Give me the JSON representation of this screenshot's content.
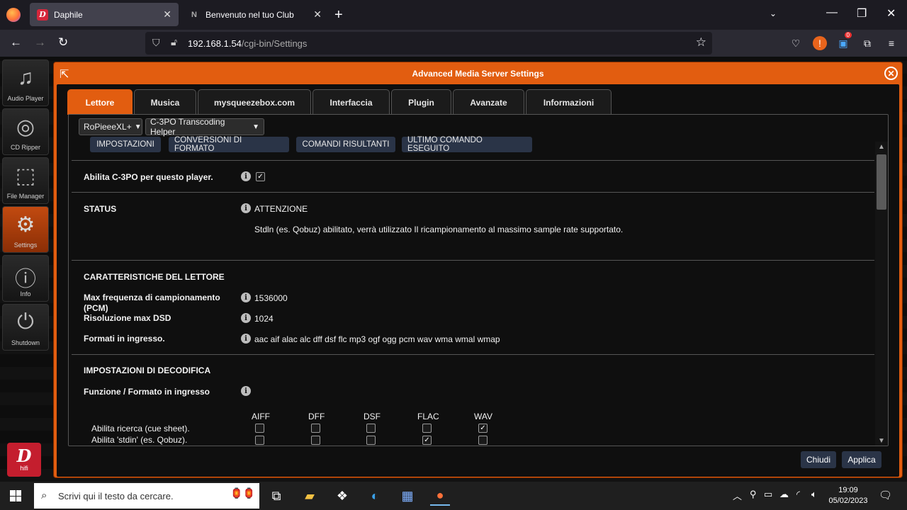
{
  "browser": {
    "tabs": [
      {
        "title": "Daphile",
        "favicon": "D"
      },
      {
        "title": "Benvenuto nel tuo Club",
        "favicon": "N"
      }
    ],
    "url_host": "192.168.1.54",
    "url_path": "/cgi-bin/Settings",
    "notification_count": "0"
  },
  "sidebar": {
    "items": [
      {
        "label": "Audio Player",
        "icon": "music-note-icon"
      },
      {
        "label": "CD Ripper",
        "icon": "disc-icon"
      },
      {
        "label": "File Manager",
        "icon": "box-icon"
      },
      {
        "label": "Settings",
        "icon": "gears-icon"
      },
      {
        "label": "Info",
        "icon": "info-icon"
      },
      {
        "label": "Shutdown",
        "icon": "power-icon"
      }
    ],
    "logo_letter": "D",
    "logo_text": "hifi"
  },
  "dialog": {
    "title": "Advanced Media Server Settings",
    "tabs": [
      "Lettore",
      "Musica",
      "mysqueezebox.com",
      "Interfaccia",
      "Plugin",
      "Avanzate",
      "Informazioni"
    ],
    "player_select": "RoPieeeXL+",
    "plugin_select": "C-3PO Transcoding Helper",
    "subbuttons": [
      "IMPOSTAZIONI",
      "CONVERSIONI DI FORMATO",
      "COMANDI RISULTANTI",
      "ULTIMO COMANDO ESEGUITO"
    ],
    "enable_label": "Abilita C-3PO per questo player.",
    "status_label": "STATUS",
    "status_value": "ATTENZIONE",
    "status_message": "Stdln (es. Qobuz) abilitato, verrà utilizzato Il ricampionamento al massimo sample rate supportato.",
    "section_player": "CARATTERISTICHE DEL LETTORE",
    "max_freq_label": "Max frequenza di campionamento (PCM)",
    "max_freq_value": "1536000",
    "dsd_label": "Risoluzione max DSD",
    "dsd_value": "1024",
    "formats_label": "Formati in ingresso.",
    "formats_value": "aac aif alac alc dff dsf flc mp3 ogf ogg pcm wav wma wmal wmap",
    "section_decode": "IMPOSTAZIONI DI DECODIFICA",
    "function_label": "Funzione / Formato in ingresso",
    "columns": [
      "AIFF",
      "DFF",
      "DSF",
      "FLAC",
      "WAV"
    ],
    "rows": [
      {
        "label": "Abilita ricerca (cue sheet).",
        "checked": [
          false,
          false,
          false,
          false,
          true
        ]
      },
      {
        "label": "Abilita 'stdin' (es. Qobuz).",
        "checked": [
          false,
          false,
          false,
          true,
          false
        ]
      }
    ],
    "close_label": "Chiudi",
    "apply_label": "Applica"
  },
  "taskbar": {
    "search_placeholder": "Scrivi qui il testo da cercare.",
    "time": "19:09",
    "date": "05/02/2023"
  }
}
